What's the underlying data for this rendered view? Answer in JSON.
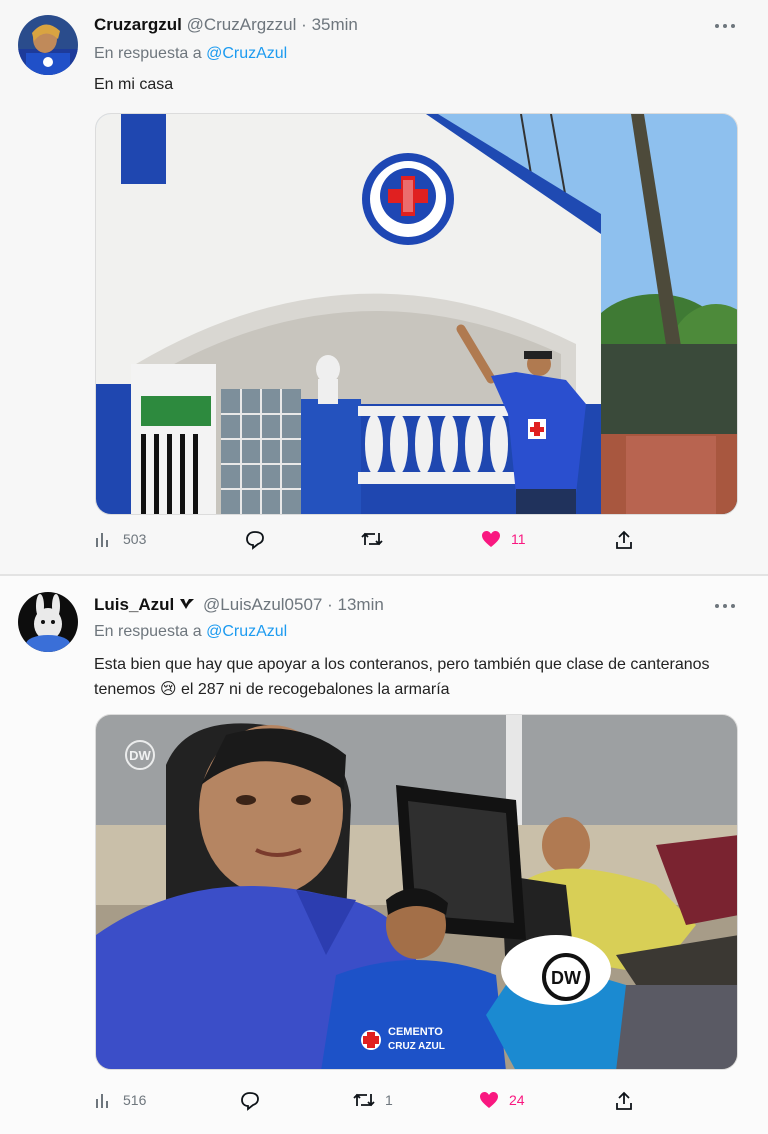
{
  "tweets": [
    {
      "display_name": "Cruzargzul",
      "handle": "@CruzArgzzul",
      "dot": "·",
      "time": "35min",
      "reply_prefix": "En respuesta a",
      "reply_to": "@CruzAzul",
      "text": "En mi casa",
      "verified": false,
      "stats": {
        "views": "503",
        "replies": "",
        "retweets": "",
        "likes": "11"
      },
      "liked": true
    },
    {
      "display_name": "Luis_Azul",
      "handle": "@LuisAzul0507",
      "dot": "·",
      "time": "13min",
      "reply_prefix": "En respuesta a",
      "reply_to": "@CruzAzul",
      "text": "Esta bien que hay que apoyar a los conteranos, pero también que clase de canteranos tenemos 😢 el 287 ni de recogebalones la armaría",
      "verified": true,
      "stats": {
        "views": "516",
        "replies": "",
        "retweets": "1",
        "likes": "24"
      },
      "liked": true
    }
  ],
  "media_text": {
    "badge_text": "DW",
    "sponsor_text": "CEMENTO",
    "sponsor_text2": "CRUZ AZUL",
    "microphone_text": "DW"
  },
  "colors": {
    "accent": "#1d9bf0",
    "like": "#f91880",
    "muted": "#6e767d",
    "cruz_azul_blue": "#1d45b4"
  },
  "icons": [
    "views-icon",
    "reply-icon",
    "retweet-icon",
    "heart-icon",
    "share-icon",
    "more-icon",
    "verified-icon"
  ]
}
